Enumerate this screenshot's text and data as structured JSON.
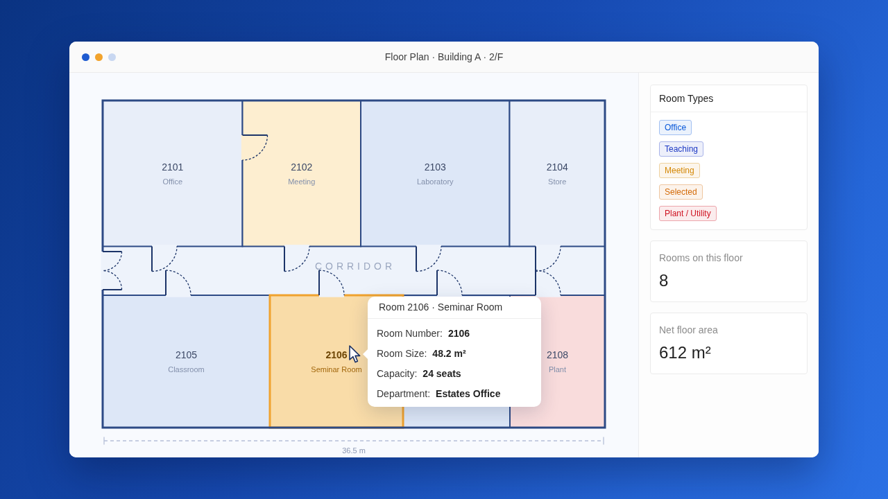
{
  "window": {
    "title": "Floor Plan · Building A · 2/F"
  },
  "floor_plan": {
    "rooms": [
      {
        "number": "2101",
        "name": "Office",
        "color": "#e8eef9",
        "selected": false
      },
      {
        "number": "2102",
        "name": "Meeting",
        "color": "#fdeed0",
        "selected": false
      },
      {
        "number": "2103",
        "name": "Laboratory",
        "color": "#dde7f7",
        "selected": false
      },
      {
        "number": "2104",
        "name": "Store",
        "color": "#e8eef9",
        "selected": false
      },
      {
        "number": "2105",
        "name": "Classroom",
        "color": "#dde7f7",
        "selected": false
      },
      {
        "number": "2106",
        "name": "Seminar Room",
        "color": "#f9dca8",
        "selected": true
      },
      {
        "color": "#dde7f7",
        "selected": false
      },
      {
        "number": "2108",
        "name": "Plant",
        "color": "#f9dcdc",
        "selected": false
      }
    ],
    "corridor": {
      "label": "CORRIDOR"
    },
    "dimension": {
      "label": "36.5 m"
    }
  },
  "tooltip": {
    "title": "Room 2106 · Seminar Room",
    "fields": [
      {
        "label": "Room Number:",
        "value": "2106"
      },
      {
        "label": "Room Size:",
        "value": "48.2 m²"
      },
      {
        "label": "Capacity:",
        "value": "24 seats"
      },
      {
        "label": "Department:",
        "value": "Estates Office"
      }
    ]
  },
  "sidebar": {
    "legend": {
      "title": "Room Types",
      "items": [
        {
          "label": "Office",
          "color": "#0958d9"
        },
        {
          "label": "Teaching",
          "color": "#1d39c4"
        },
        {
          "label": "Meeting",
          "color": "#d48806"
        },
        {
          "label": "Selected",
          "color": "#d46b08"
        },
        {
          "label": "Plant / Utility",
          "color": "#cf1322"
        }
      ]
    },
    "stats": [
      {
        "label": "Rooms on this floor",
        "value": "8"
      },
      {
        "label": "Net floor area",
        "value": "612 m²"
      }
    ]
  }
}
